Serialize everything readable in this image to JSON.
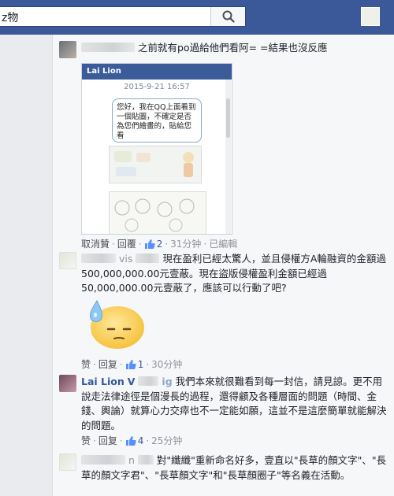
{
  "search": {
    "value": "z物"
  },
  "comments": [
    {
      "text": "之前就有po過給他們看阿= =結果也沒反應",
      "attachment": {
        "app_name": "Lai Lion",
        "date": "2015-9-21 16:57",
        "bubble_text": "您好，我在QQ上面看到一個貼圖，不確定是否為您們繪畫的，貼給您看"
      },
      "actions": {
        "unlike": "取消贊",
        "reply": "回覆",
        "likes": "2",
        "time": "31分钟",
        "edited": "已編輯"
      }
    },
    {
      "name_fragment": "vis",
      "text": "現在盈利已經太驚人，並且侵權方A輪融資的金額過500,000,000.00元壹蔽。現在盜版侵權盈利金額已經過50,000,000.00元壹蔽了，應該可以行動了吧?",
      "actions": {
        "like": "赞",
        "reply": "回复",
        "likes": "1",
        "time": "30分钟"
      }
    },
    {
      "name": "Lai Lion",
      "name_fragment": "V",
      "name_fragment2": "ig",
      "text": "我們本來就很難看到每一封信，請見諒。更不用說走法律途徑是個漫長的過程，還得顧及各種層面的問題（時間、金錢、輿論）就算心力交瘁也不一定能如願，這並不是這麼簡單就能解決的問題。",
      "actions": {
        "like": "赞",
        "reply": "回复",
        "likes": "4",
        "time": "25分钟"
      }
    },
    {
      "name_fragment": "n",
      "text": "對\"纖纖\"重新命名好多，壹直以\"長草的顏文字\"、\"長草的顏文字君\"、\"長草顏文字\"和\"長草顏圈子\"等名義在活動。"
    }
  ],
  "colors": {
    "facebook_blue": "#3b5998",
    "link_blue": "#365899",
    "background": "#e9ebee"
  }
}
